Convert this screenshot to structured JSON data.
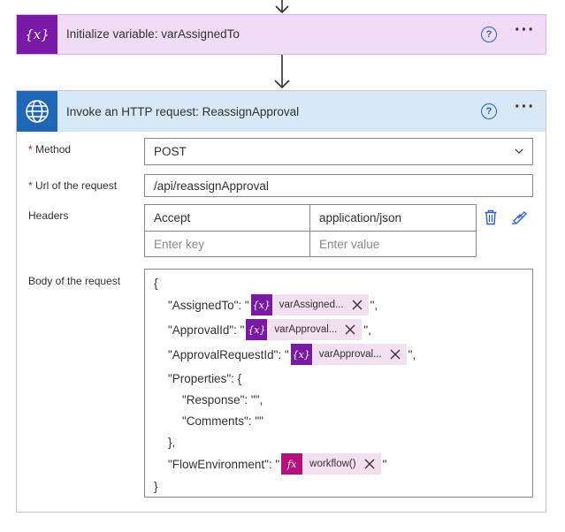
{
  "card1": {
    "title": "Initialize variable: varAssignedTo",
    "icon": "variable-icon",
    "accent": "#7a19a6",
    "header_color": "#f0dcf6"
  },
  "card2": {
    "title": "Invoke an HTTP request: ReassignApproval",
    "icon": "globe-icon",
    "accent": "#1f67b6",
    "header_color": "#d7e8f8"
  },
  "help_glyph": "?",
  "more_glyph": "···",
  "required_mark": "*",
  "method": {
    "label": "Method",
    "value": "POST"
  },
  "url": {
    "label": "Url of the request",
    "value": "/api/reassignApproval"
  },
  "headers": {
    "label": "Headers",
    "rows": [
      {
        "key": "Accept",
        "value": "application/json"
      }
    ],
    "key_placeholder": "Enter key",
    "value_placeholder": "Enter value"
  },
  "body": {
    "label": "Body of the request",
    "open_brace": "{",
    "close_brace": "}",
    "assigned_prefix": "\"AssignedTo\": \"",
    "assigned_token": "varAssigned...",
    "assigned_suffix": "\",",
    "approval_prefix": "\"ApprovalId\": \"",
    "approval_token": "varApproval...",
    "approval_suffix": "\",",
    "approvalreq_prefix": "\"ApprovalRequestId\": \"",
    "approvalreq_token": "varApproval...",
    "approvalreq_suffix": "\",",
    "properties_open": "\"Properties\": {",
    "response_line": "\"Response\": \"\",",
    "comments_line": "\"Comments\": \"\"",
    "properties_close": "},",
    "flowenv_prefix": "\"FlowEnvironment\": \"",
    "flowenv_token": "workflow()",
    "flowenv_suffix": "\"",
    "var_glyph": "{x}",
    "fx_glyph": "fx"
  }
}
